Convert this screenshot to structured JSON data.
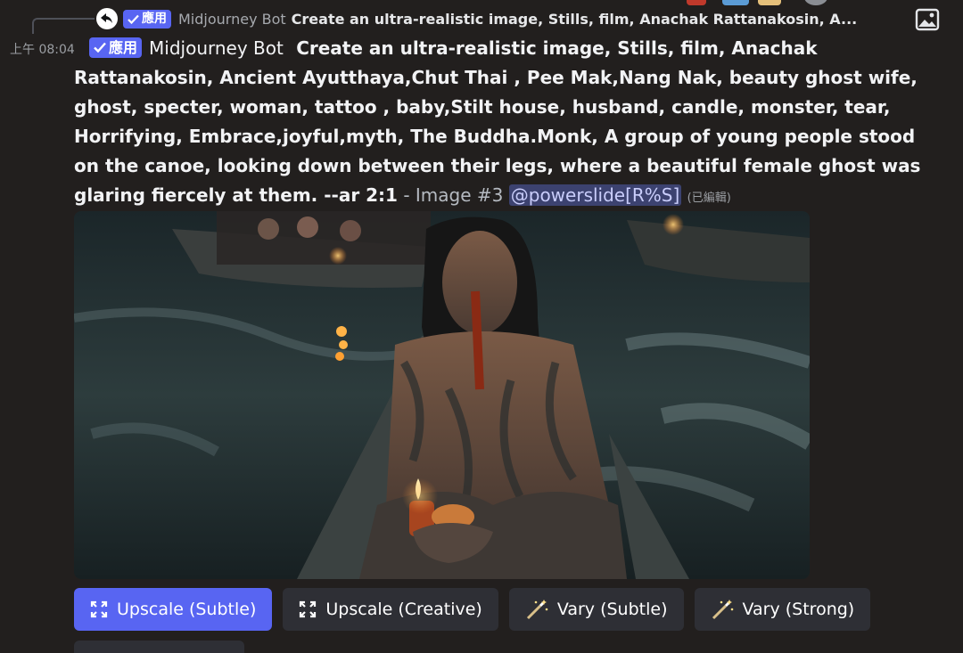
{
  "reply": {
    "badge_label": "應用",
    "author": "Midjourney Bot",
    "text": "Create an ultra-realistic image, Stills, film, Anachak Rattanakosin, A..."
  },
  "message": {
    "timestamp": "上午 08:04",
    "badge_label": "應用",
    "author": "Midjourney Bot",
    "prompt": "Create an ultra-realistic image, Stills, film, Anachak Rattanakosin, Ancient Ayutthaya,Chut Thai , Pee Mak,Nang Nak, beauty ghost wife, ghost, specter, woman, tattoo , baby,Stilt house, husband, candle, monster, tear, Horrifying, Embrace,joyful,myth, The Buddha.Monk, A group of young people stood on the canoe, looking down between their legs, where a beautiful female ghost was glaring fiercely at them. --ar 2:1",
    "separator": " - ",
    "image_label": "Image #3",
    "mention": "@powerslide[R%S]",
    "edited": "(已編輯)"
  },
  "buttons": [
    {
      "label": "Upscale (Subtle)",
      "icon": "expand-icon",
      "primary": true
    },
    {
      "label": "Upscale (Creative)",
      "icon": "expand-icon",
      "primary": false
    },
    {
      "label": "Vary (Subtle)",
      "icon": "magic-wand-icon",
      "primary": false
    },
    {
      "label": "Vary (Strong)",
      "icon": "magic-wand-icon",
      "primary": false
    }
  ],
  "colors": {
    "background": "#221f1e",
    "badge": "#5865f2",
    "primary_button": "#5865f2",
    "secondary_button": "#2e2f35",
    "mention_bg": "#3c4270",
    "mention_text": "#c9cdfb"
  }
}
